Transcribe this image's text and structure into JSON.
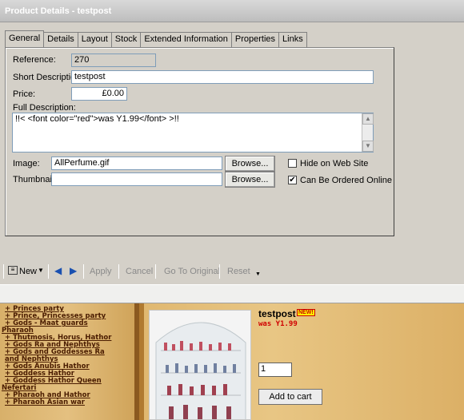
{
  "window": {
    "title": "Product Details - testpost"
  },
  "tabs": [
    "General",
    "Details",
    "Layout",
    "Stock",
    "Extended Information",
    "Properties",
    "Links"
  ],
  "form": {
    "reference_label": "Reference:",
    "reference_value": "270",
    "short_desc_label": "Short Description:",
    "short_desc_value": "testpost",
    "price_label": "Price:",
    "price_value": "£0.00",
    "full_desc_label": "Full Description:",
    "full_desc_value": "!!< <font color=\"red\">was Y1.99</font> >!!",
    "image_label": "Image:",
    "image_value": "AllPerfume.gif",
    "thumbnail_label": "Thumbnail:",
    "thumbnail_value": "",
    "browse_label": "Browse...",
    "hide_label": "Hide on Web Site",
    "hide_checked": false,
    "online_label": "Can Be Ordered Online",
    "online_checked": true
  },
  "toolbar": {
    "new_label": "New",
    "apply_label": "Apply",
    "cancel_label": "Cancel",
    "goto_label": "Go To Original",
    "reset_label": "Reset"
  },
  "preview": {
    "menu_items": [
      "+ Princes party",
      "+ Prince, Princesses party",
      "+ Gods - Maat guards",
      "Pharaoh",
      "+ Thutmosis, Horus, Hathor",
      "+ Gods Ra and Nephthys",
      "+ Gods and Goddesses Ra",
      "and Nephthys",
      "+ Gods Anubis Hathor",
      "+ Goddess Hathor",
      "+ Goddess Hathor Queen",
      "Nefertari",
      "+ Pharaoh and Hathor",
      "+ Pharaoh Asian war"
    ],
    "product_name": "testpost",
    "new_badge": "NEW!",
    "was_price": "was Y1.99",
    "quantity": "1",
    "add_to_cart_label": "Add to cart"
  }
}
